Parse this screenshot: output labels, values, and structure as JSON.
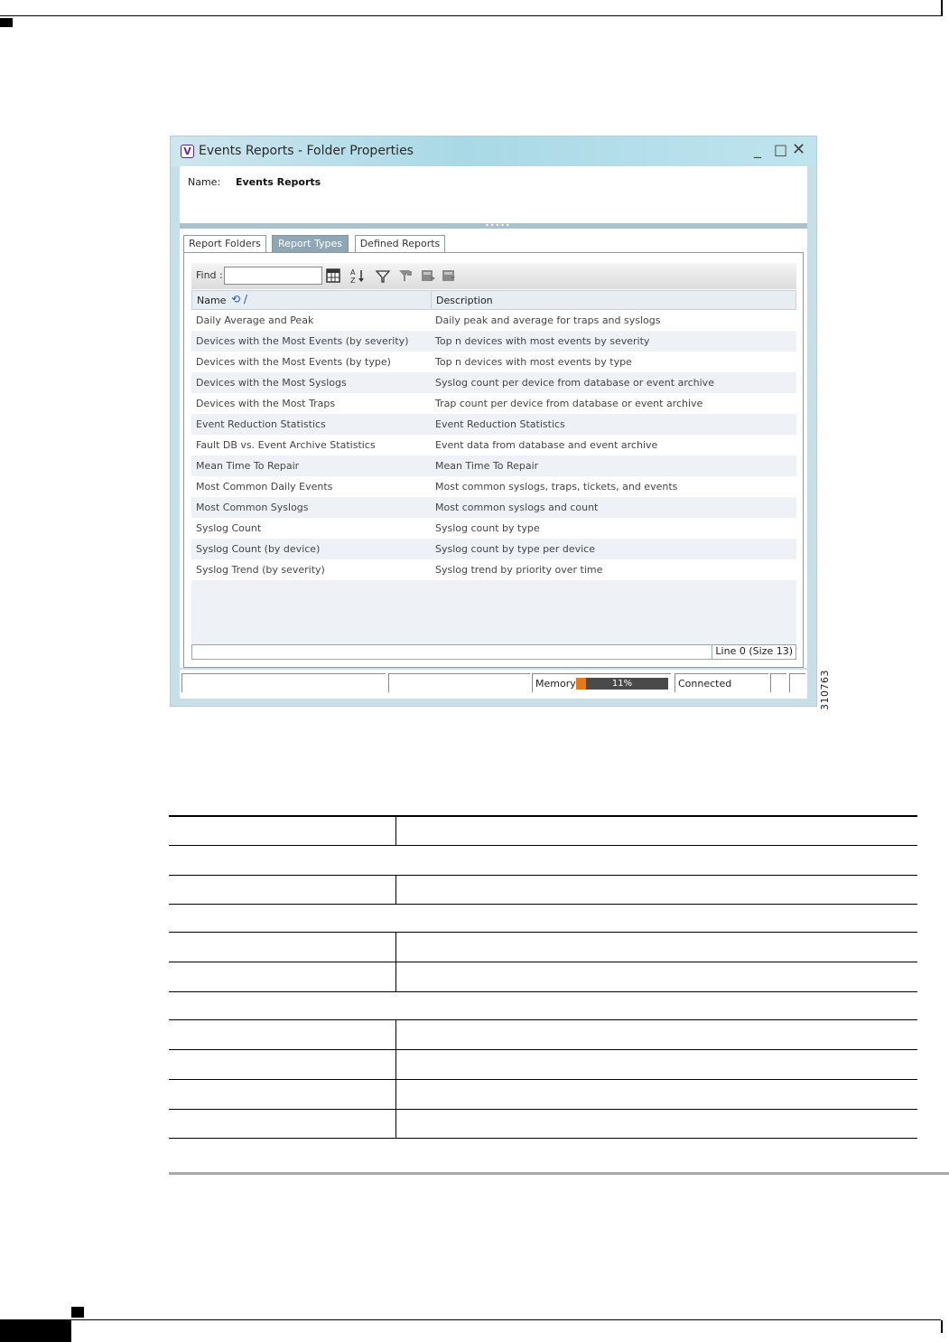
{
  "window": {
    "title": "Events Reports - Folder Properties",
    "app_icon_letter": "V",
    "minimize": "_",
    "maximize": "□",
    "close": "✕"
  },
  "properties": {
    "name_label": "Name:",
    "name_value": "Events Reports"
  },
  "tabs": [
    {
      "label": "Report Folders",
      "active": false
    },
    {
      "label": "Report Types",
      "active": true
    },
    {
      "label": "Defined Reports",
      "active": false
    }
  ],
  "toolbar": {
    "find_label": "Find :",
    "find_value": "",
    "icons": [
      "column-chooser-icon",
      "sort-az-icon",
      "filter-icon",
      "clear-filter-icon",
      "export-icon",
      "print-icon"
    ]
  },
  "table": {
    "columns": [
      "Name",
      "Description"
    ],
    "rows": [
      {
        "name": "Daily Average and Peak",
        "description": "Daily peak and average for traps and syslogs"
      },
      {
        "name": "Devices with the Most Events (by severity)",
        "description": "Top n devices with most events by severity"
      },
      {
        "name": "Devices with the Most Events (by type)",
        "description": "Top n devices with most events by type"
      },
      {
        "name": "Devices with the Most Syslogs",
        "description": "Syslog count per device from database or event archive"
      },
      {
        "name": "Devices with the Most Traps",
        "description": "Trap count per device from database or event archive"
      },
      {
        "name": "Event Reduction Statistics",
        "description": "Event Reduction Statistics"
      },
      {
        "name": "Fault DB vs. Event Archive Statistics",
        "description": "Event data from database and event archive"
      },
      {
        "name": "Mean Time To Repair",
        "description": "Mean Time To Repair"
      },
      {
        "name": "Most Common Daily Events",
        "description": "Most common syslogs, traps, tickets, and events"
      },
      {
        "name": "Most Common Syslogs",
        "description": "Most common syslogs and count"
      },
      {
        "name": "Syslog Count",
        "description": "Syslog count by type"
      },
      {
        "name": "Syslog Count (by device)",
        "description": "Syslog count by type per device"
      },
      {
        "name": "Syslog Trend (by severity)",
        "description": "Syslog trend by priority over time"
      }
    ],
    "footer_status": "Line 0 (Size 13)"
  },
  "statusbar": {
    "memory_label": "Memory:",
    "memory_percent": 11,
    "memory_text": "11%",
    "connection": "Connected"
  },
  "figure_number": "310763",
  "colors": {
    "title_gradient": "#a9d9e6",
    "active_tab": "#8ea7b3",
    "memory_fill": "#e07a1c",
    "row_alt": "#eef2f6"
  }
}
